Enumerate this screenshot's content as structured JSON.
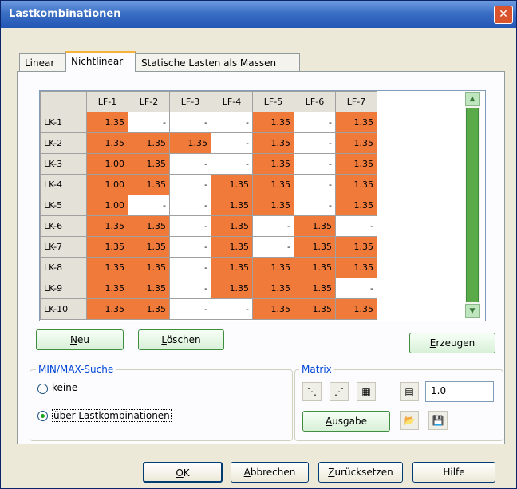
{
  "window": {
    "title": "Lastkombinationen",
    "close_glyph": "✕"
  },
  "tabs": [
    {
      "label": "Linear"
    },
    {
      "label": "Nichtlinear"
    },
    {
      "label": "Statische Lasten als Massen"
    }
  ],
  "grid": {
    "columns": [
      "LF-1",
      "LF-2",
      "LF-3",
      "LF-4",
      "LF-5",
      "LF-6",
      "LF-7"
    ],
    "rows": [
      {
        "label": "LK-1",
        "cells": [
          "1.35",
          "-",
          "-",
          "-",
          "1.35",
          "-",
          "1.35"
        ]
      },
      {
        "label": "LK-2",
        "cells": [
          "1.35",
          "1.35",
          "1.35",
          "-",
          "1.35",
          "-",
          "1.35"
        ]
      },
      {
        "label": "LK-3",
        "cells": [
          "1.00",
          "1.35",
          "-",
          "-",
          "1.35",
          "-",
          "1.35"
        ]
      },
      {
        "label": "LK-4",
        "cells": [
          "1.00",
          "1.35",
          "-",
          "1.35",
          "1.35",
          "-",
          "1.35"
        ]
      },
      {
        "label": "LK-5",
        "cells": [
          "1.00",
          "-",
          "-",
          "1.35",
          "1.35",
          "-",
          "1.35"
        ]
      },
      {
        "label": "LK-6",
        "cells": [
          "1.35",
          "1.35",
          "-",
          "1.35",
          "-",
          "1.35",
          "-"
        ]
      },
      {
        "label": "LK-7",
        "cells": [
          "1.35",
          "1.35",
          "-",
          "1.35",
          "-",
          "1.35",
          "1.35"
        ]
      },
      {
        "label": "LK-8",
        "cells": [
          "1.35",
          "1.35",
          "-",
          "1.35",
          "1.35",
          "1.35",
          "1.35"
        ]
      },
      {
        "label": "LK-9",
        "cells": [
          "1.35",
          "1.35",
          "-",
          "1.35",
          "1.35",
          "1.35",
          "-"
        ]
      },
      {
        "label": "LK-10",
        "cells": [
          "1.35",
          "1.35",
          "-",
          "-",
          "1.35",
          "1.35",
          "1.35"
        ]
      }
    ],
    "active_color": "#f07a3a"
  },
  "buttons": {
    "neu": {
      "first": "N",
      "rest": "eu"
    },
    "loeschen": {
      "first": "L",
      "rest": "öschen"
    },
    "erzeugen": {
      "first": "E",
      "rest": "rzeugen"
    },
    "ausgabe": {
      "first": "A",
      "rest": "usgabe"
    },
    "ok": {
      "first": "O",
      "rest": "K"
    },
    "abbrechen": {
      "first": "A",
      "rest": "bbrechen"
    },
    "zuruecksetzen": {
      "first": "Z",
      "rest": "urücksetzen"
    },
    "hilfe": "Hilfe"
  },
  "minmax": {
    "title": "MIN/MAX-Suche",
    "options": [
      {
        "label": "keine",
        "selected": false
      },
      {
        "label": "über Lastkombinationen",
        "selected": true
      }
    ]
  },
  "matrix": {
    "title": "Matrix",
    "value": "1.0"
  }
}
